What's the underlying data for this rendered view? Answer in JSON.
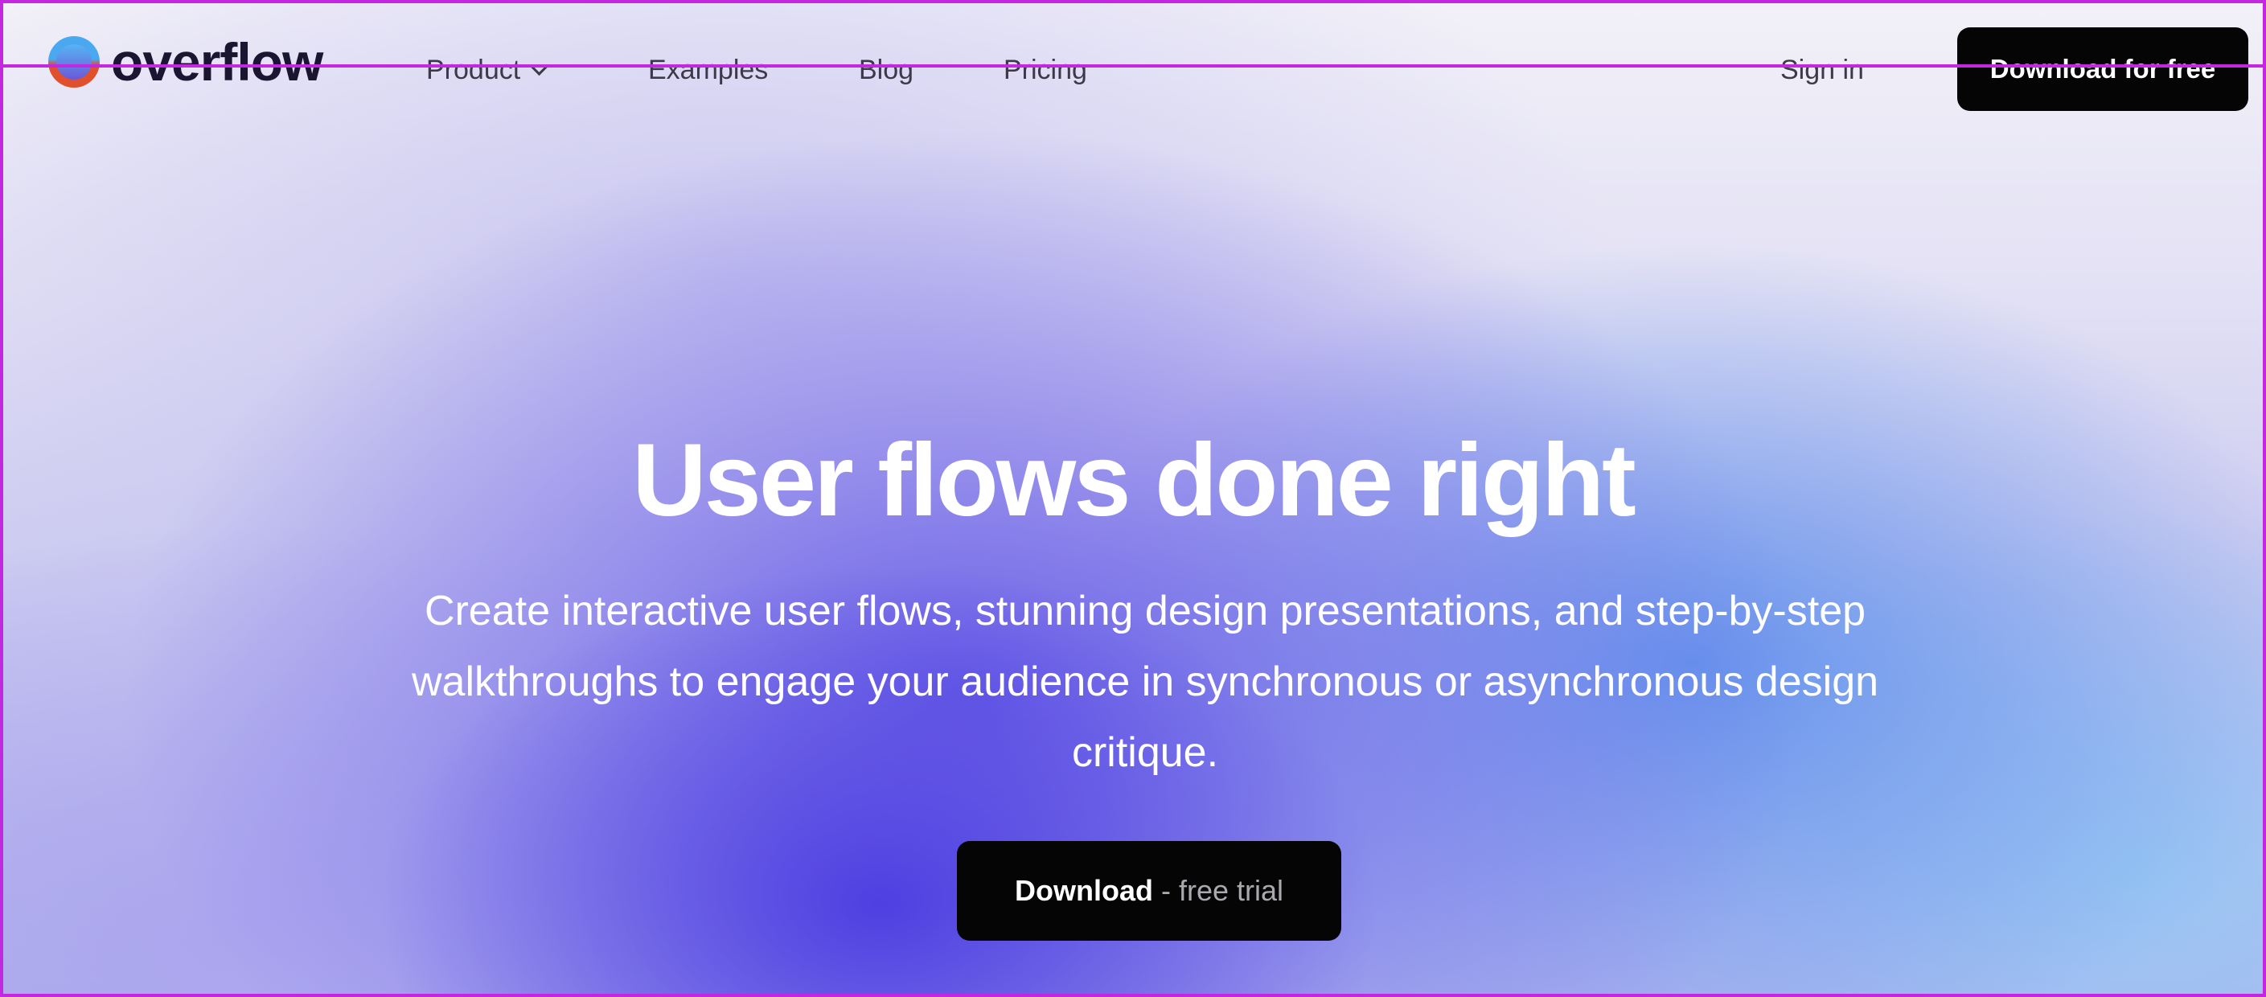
{
  "brand": {
    "name": "overflow",
    "logo_icon": "overflow-logo-circle"
  },
  "nav": {
    "items": [
      {
        "label": "Product",
        "icon": "chevron-down-icon"
      },
      {
        "label": "Examples"
      },
      {
        "label": "Blog"
      },
      {
        "label": "Pricing"
      }
    ],
    "sign_in": "Sign in",
    "cta": "Download for free"
  },
  "hero": {
    "title": "User flows done right",
    "subtitle": "Create interactive user flows, stunning design presentations, and step-by-step walkthroughs to engage your audience in synchronous or asynchronous design critique.",
    "cta_strong": "Download",
    "cta_light": "- free trial"
  },
  "colors": {
    "frame_border": "#c427e0",
    "button_bg": "#050505",
    "gradient_core": "#4b3ce1",
    "gradient_blue": "#568cec"
  }
}
